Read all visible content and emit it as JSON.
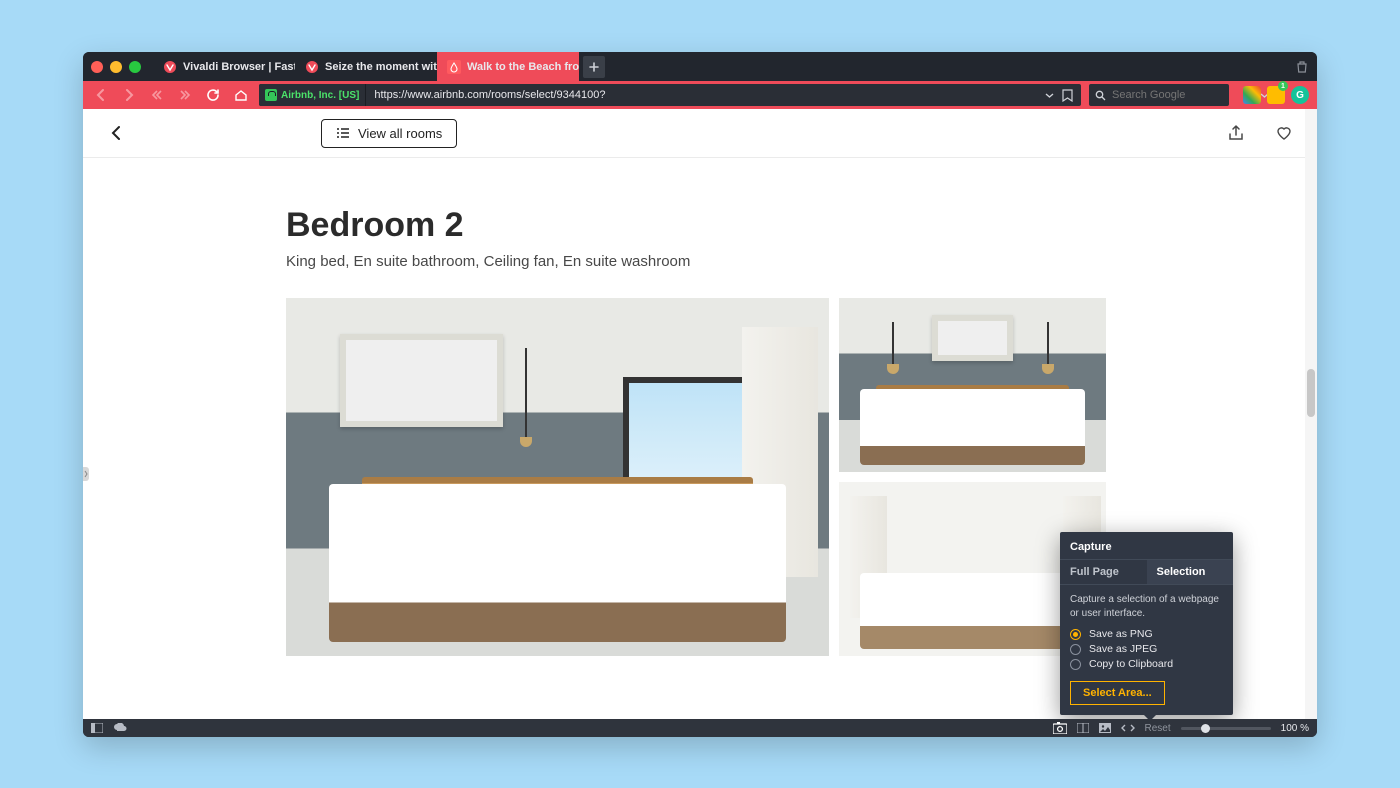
{
  "titlebar": {
    "tabs": [
      {
        "label": "Vivaldi Browser | Fast & Flexib"
      },
      {
        "label": "Seize the moment with Vivald"
      },
      {
        "label": "Walk to the Beach from Enter"
      }
    ]
  },
  "toolbar": {
    "ev_label": "Airbnb, Inc. [US]",
    "url": "https://www.airbnb.com/rooms/select/9344100?",
    "search_placeholder": "Search Google"
  },
  "page": {
    "view_all_label": "View all rooms",
    "title": "Bedroom 2",
    "subtitle": "King bed, En suite bathroom, Ceiling fan, En suite washroom"
  },
  "capture": {
    "title": "Capture",
    "tab_full": "Full Page",
    "tab_selection": "Selection",
    "description": "Capture a selection of a webpage or user interface.",
    "opt_png": "Save as PNG",
    "opt_jpeg": "Save as JPEG",
    "opt_clip": "Copy to Clipboard",
    "button": "Select Area..."
  },
  "status": {
    "reset": "Reset",
    "zoom": "100 %"
  }
}
